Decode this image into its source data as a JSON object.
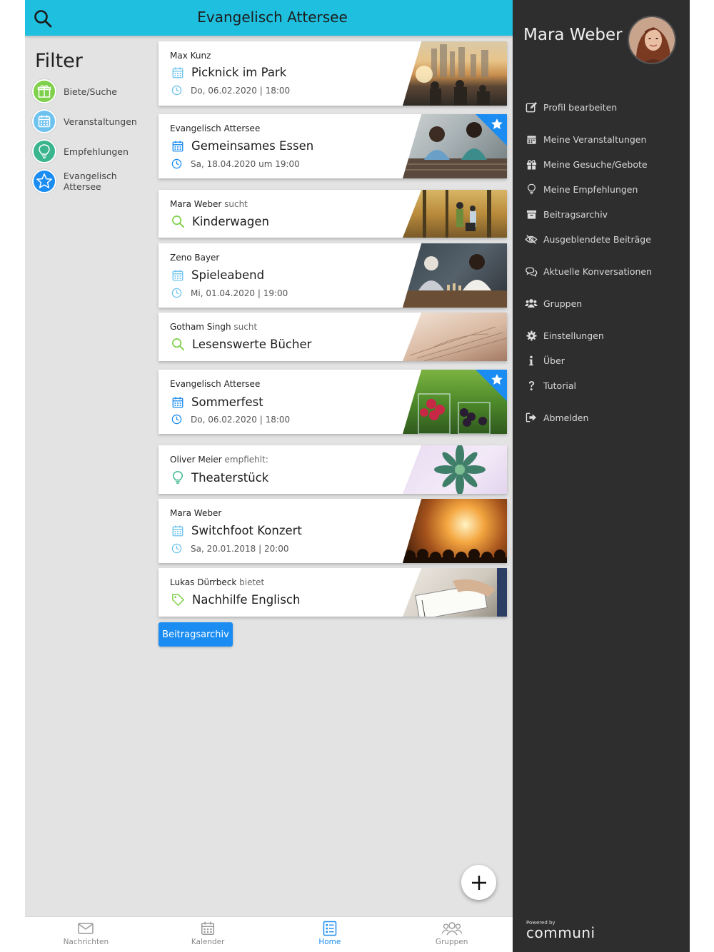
{
  "header": {
    "title": "Evangelisch Attersee"
  },
  "filter": {
    "title": "Filter",
    "items": [
      {
        "label": "Biete/Suche",
        "icon": "gift-icon",
        "color": "#7fd04a"
      },
      {
        "label": "Veranstaltungen",
        "icon": "calendar-icon",
        "color": "#6ec3ee"
      },
      {
        "label": "Empfehlungen",
        "icon": "lightbulb-icon",
        "color": "#3bb58d"
      },
      {
        "label": "Evangelisch Attersee",
        "icon": "star-icon",
        "color": "#1a8cf2"
      }
    ]
  },
  "feed": [
    {
      "author": "Max Kunz",
      "verb": "",
      "title": "Picknick im Park",
      "date": "Do, 06.02.2020 | 18:00",
      "type": "event"
    },
    {
      "author": "Evangelisch Attersee",
      "verb": "",
      "title": "Gemeinsames Essen",
      "date": "Sa, 18.04.2020 um 19:00",
      "type": "event",
      "featured": true
    },
    {
      "author": "Mara Weber",
      "verb": " sucht",
      "title": "Kinderwagen",
      "date": "",
      "type": "search"
    },
    {
      "author": "Zeno Bayer",
      "verb": "",
      "title": "Spieleabend",
      "date": "Mi, 01.04.2020 | 19:00",
      "type": "event"
    },
    {
      "author": "Gotham Singh",
      "verb": " sucht",
      "title": "Lesenswerte Bücher",
      "date": "",
      "type": "search"
    },
    {
      "author": "Evangelisch Attersee",
      "verb": "",
      "title": "Sommerfest",
      "date": "Do, 06.02.2020 | 18:00",
      "type": "event",
      "featured": true
    },
    {
      "author": "Oliver Meier",
      "verb": " empfiehlt:",
      "title": "Theaterstück",
      "date": "",
      "type": "recommendation"
    },
    {
      "author": "Mara Weber",
      "verb": "",
      "title": "Switchfoot Konzert",
      "date": "Sa, 20.01.2018 | 20:00",
      "type": "event"
    },
    {
      "author": "Lukas Dürrbeck",
      "verb": " bietet",
      "title": "Nachhilfe Englisch",
      "date": "",
      "type": "offer"
    }
  ],
  "archive_button": "Beitragsarchiv",
  "bottom_nav": [
    {
      "label": "Nachrichten",
      "icon": "mail-icon"
    },
    {
      "label": "Kalender",
      "icon": "calendar-icon"
    },
    {
      "label": "Home",
      "icon": "home-list-icon",
      "active": true
    },
    {
      "label": "Gruppen",
      "icon": "groups-icon"
    }
  ],
  "drawer": {
    "user_name": "Mara Weber",
    "items": [
      {
        "label": "Profil bearbeiten",
        "icon": "edit-icon"
      },
      {
        "label": "Meine Veranstaltungen",
        "icon": "calendar-icon"
      },
      {
        "label": "Meine Gesuche/Gebote",
        "icon": "gift-icon"
      },
      {
        "label": "Meine Empfehlungen",
        "icon": "lightbulb-icon"
      },
      {
        "label": "Beitragsarchiv",
        "icon": "archive-icon"
      },
      {
        "label": "Ausgeblendete Beiträge",
        "icon": "eye-slash-icon"
      },
      {
        "label": "Aktuelle Konversationen",
        "icon": "chat-icon"
      },
      {
        "label": "Gruppen",
        "icon": "users-icon"
      },
      {
        "label": "Einstellungen",
        "icon": "gear-icon"
      },
      {
        "label": "Über",
        "icon": "info-icon"
      },
      {
        "label": "Tutorial",
        "icon": "question-icon"
      },
      {
        "label": "Abmelden",
        "icon": "logout-icon"
      }
    ],
    "powered_by": "Powered by",
    "brand": "communi"
  },
  "colors": {
    "header": "#1fbfdf",
    "accent": "#1a8cf2",
    "drawer": "#2e2e2e",
    "background": "#e3e3e3"
  }
}
